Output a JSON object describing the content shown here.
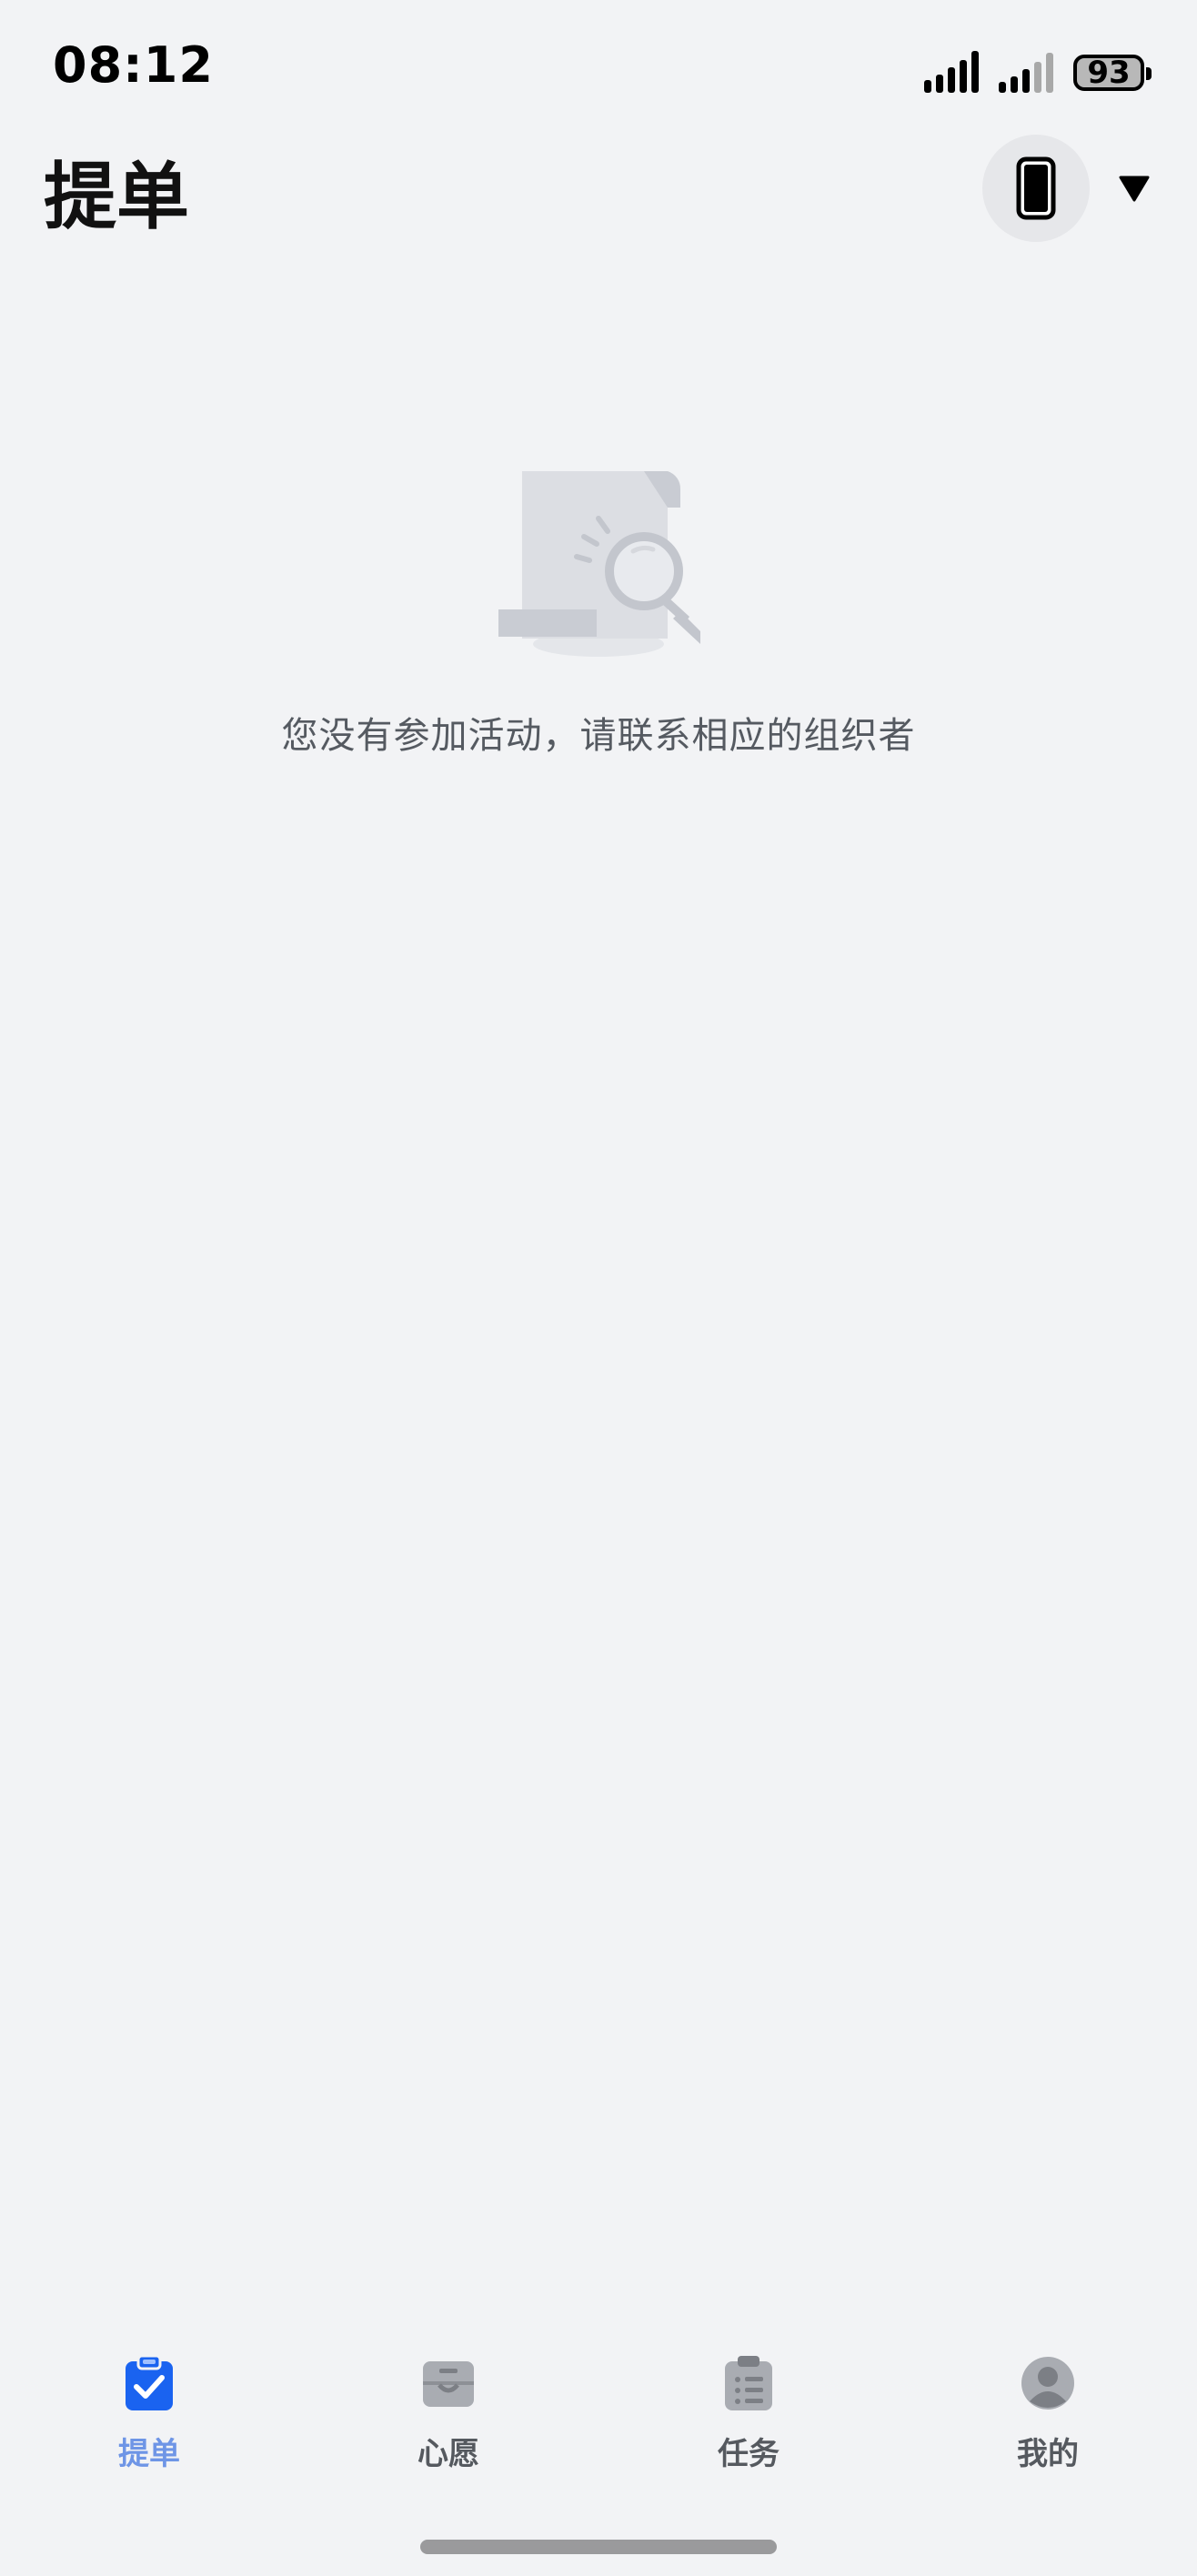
{
  "status_bar": {
    "time": "08:12",
    "battery_level": "93"
  },
  "header": {
    "title": "提单",
    "device_icon": "phone-icon",
    "dropdown_icon": "triangle-down-icon"
  },
  "empty_state": {
    "icon": "document-search-icon",
    "message": "您没有参加活动，请联系相应的组织者"
  },
  "tab_bar": {
    "active_color": "#6e95e6",
    "inactive_color": "#55595f",
    "tabs": [
      {
        "label": "提单",
        "icon": "clipboard-check-icon",
        "active": true
      },
      {
        "label": "心愿",
        "icon": "inbox-icon",
        "active": false
      },
      {
        "label": "任务",
        "icon": "task-list-icon",
        "active": false
      },
      {
        "label": "我的",
        "icon": "user-avatar-icon",
        "active": false
      }
    ]
  }
}
